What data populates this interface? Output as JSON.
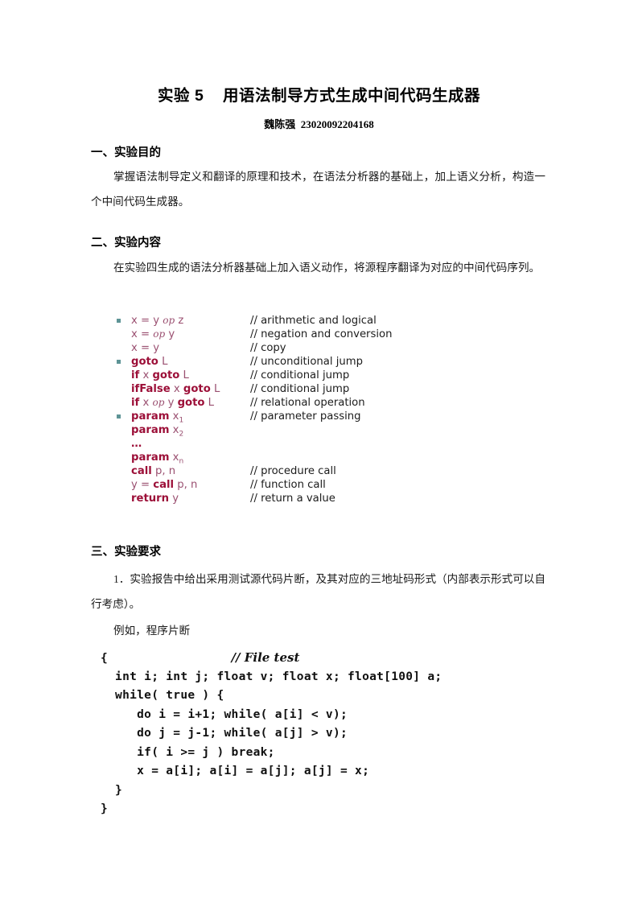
{
  "document": {
    "title": "实验 5    用语法制导方式生成中间代码生成器",
    "byline": "魏陈强  23020092204168"
  },
  "sections": [
    {
      "heading": "一、实验目的",
      "paragraphs": [
        "掌握语法制导定义和翻译的原理和技术，在语法分析器的基础上，加上语义分析，构造一个中间代码生成器。"
      ]
    },
    {
      "heading": "二、实验内容",
      "paragraphs": [
        "在实验四生成的语法分析器基础上加入语义动作，将源程序翻译为对应的中间代码序列。"
      ]
    },
    {
      "heading": "三、实验要求",
      "paragraphs": [
        "1．实验报告中给出采用测试源代码片断，及其对应的三地址码形式（内部表示形式可以自行考虑）。",
        "例如，程序片断"
      ]
    }
  ],
  "three_address_listing": {
    "rows": [
      {
        "bullet": true,
        "code_html": "x = y <i class=\"op-it\">op</i> z",
        "comment": "// arithmetic and logical"
      },
      {
        "bullet": false,
        "code_html": "x = <i class=\"op-it\">op</i> y",
        "comment": "// negation and conversion"
      },
      {
        "bullet": false,
        "code_html": "x = y",
        "comment": "// copy"
      },
      {
        "bullet": true,
        "code_html": "<b class=\"kw\">goto</b> L",
        "comment": "// unconditional jump"
      },
      {
        "bullet": false,
        "code_html": "<b class=\"kw\">if</b> x <b class=\"kw\">goto</b> L",
        "comment": "// conditional jump"
      },
      {
        "bullet": false,
        "code_html": "<b class=\"kw\">ifFalse</b> x <b class=\"kw\">goto</b> L",
        "comment": "// conditional jump"
      },
      {
        "bullet": false,
        "code_html": "<b class=\"kw\">if</b> x <i class=\"op-it\">op</i> y <b class=\"kw\">goto</b> L",
        "comment": "// relational operation"
      },
      {
        "bullet": true,
        "code_html": "<b class=\"kw\">param</b> x<span class=\"sub\">1</span>",
        "comment": "// parameter passing"
      },
      {
        "bullet": false,
        "code_html": "<b class=\"kw\">param</b> x<span class=\"sub\">2</span>",
        "comment": ""
      },
      {
        "bullet": false,
        "code_html": "<span class=\"dots\">…</span>",
        "comment": ""
      },
      {
        "bullet": false,
        "code_html": "<b class=\"kw\">param</b> x<span class=\"sub\">n</span>",
        "comment": ""
      },
      {
        "bullet": false,
        "code_html": "<b class=\"kw\">call</b> p, n",
        "comment": "// procedure call"
      },
      {
        "bullet": false,
        "code_html": "y = <b class=\"kw\">call</b> p, n",
        "comment": "// function call"
      },
      {
        "bullet": false,
        "code_html": "<b class=\"kw\">return</b> y",
        "comment": "// return a value"
      }
    ]
  },
  "program_fragment": {
    "lines": [
      "{                 <i class=\"file-cmt\">// File test</i>",
      "  int i; int j; float v; float x; float[100] a;",
      "  while( true ) {",
      "     do i = i+1; while( a[i] < v);",
      "     do j = j-1; while( a[j] > v);",
      "     if( i >= j ) break;",
      "     x = a[i]; a[i] = a[j]; a[j] = x;",
      "  }",
      "}"
    ]
  },
  "colors": {
    "keyword": "#9c0f38",
    "operand": "#9a4f70",
    "comment": "#1c1c1c",
    "bullet": "#5e9496",
    "text": "#000000",
    "page_background": "#ffffff"
  }
}
